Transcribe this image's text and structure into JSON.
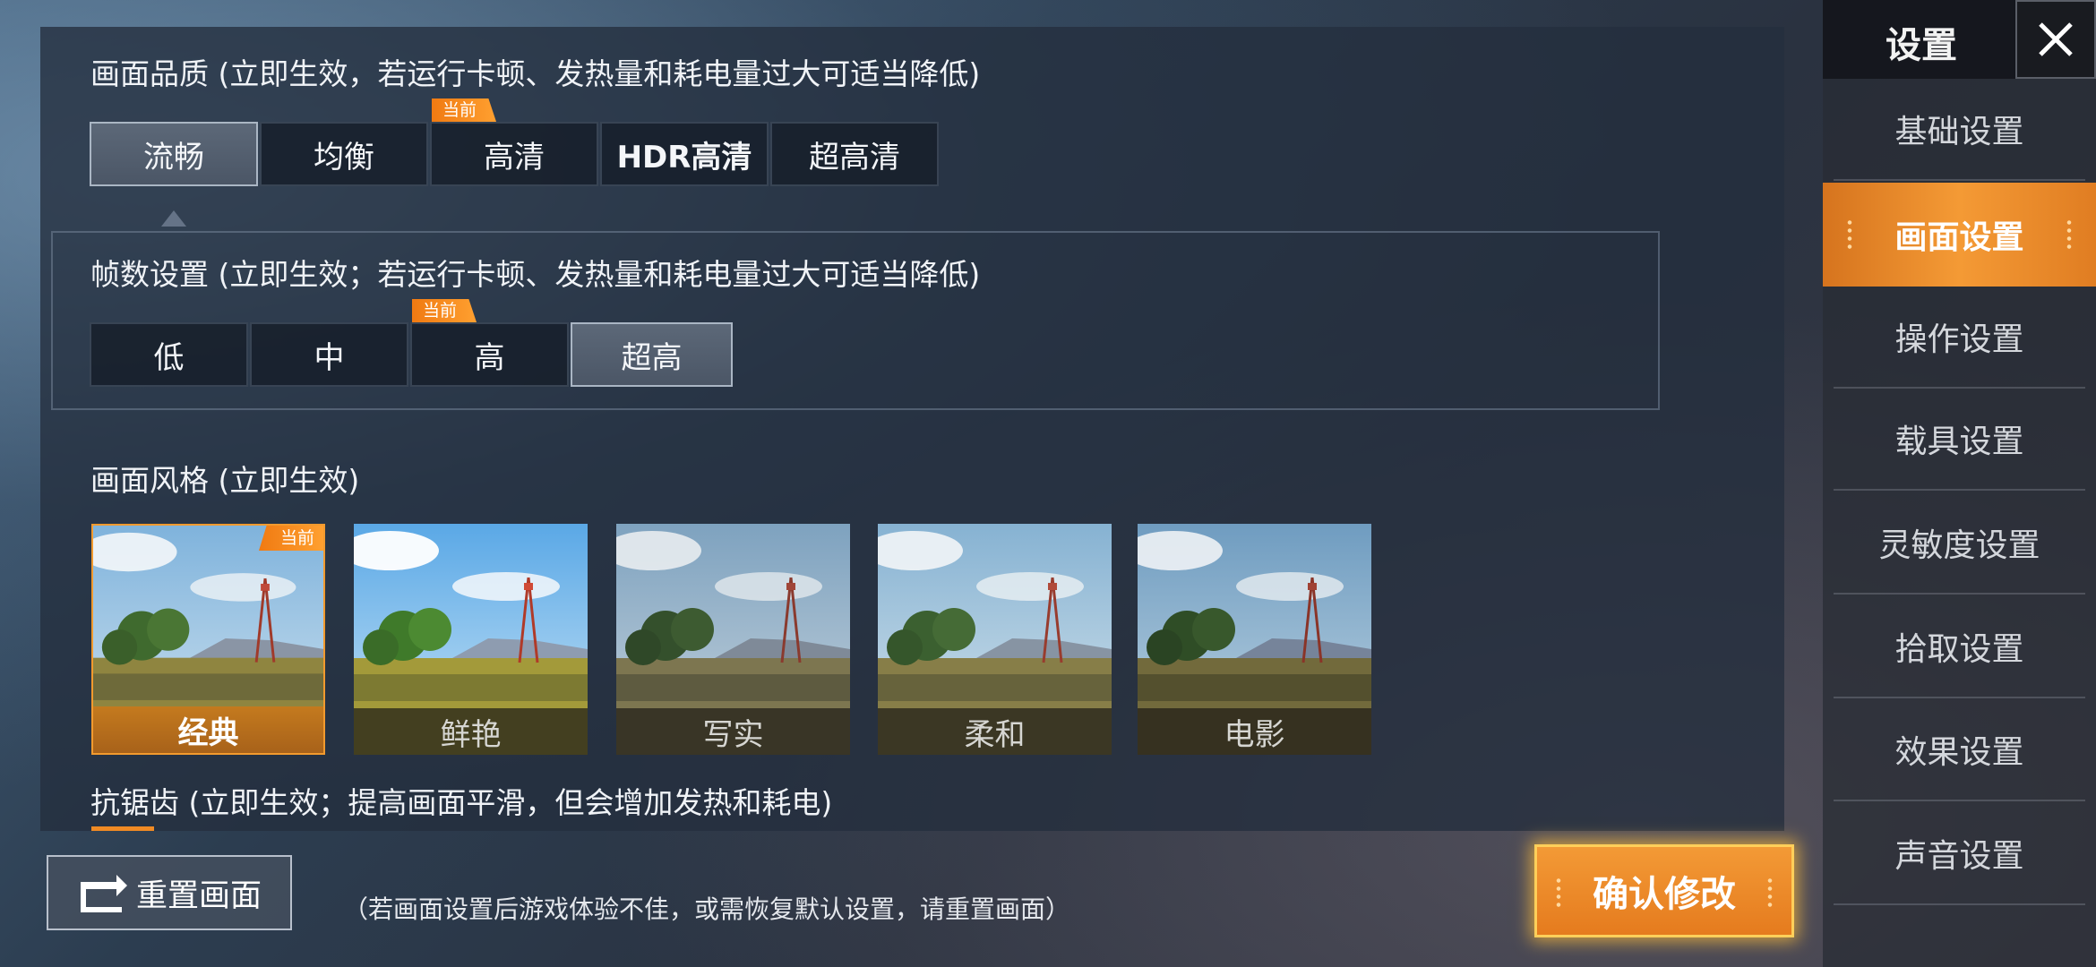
{
  "colors": {
    "accent": "#f08a24",
    "panel": "#242e3e",
    "selected_segment": "#566272"
  },
  "graphics": {
    "title": "画面品质 (立即生效，若运行卡顿、发热量和耗电量过大可适当降低)",
    "options": [
      "流畅",
      "均衡",
      "高清",
      "HDR高清",
      "超高清"
    ],
    "selected": "流畅",
    "current_tag": "当前"
  },
  "fps": {
    "title": "帧数设置 (立即生效；若运行卡顿、发热量和耗电量过大可适当降低)",
    "options": [
      "低",
      "中",
      "高",
      "超高"
    ],
    "selected": "超高",
    "current_tag": "当前"
  },
  "style": {
    "title": "画面风格 (立即生效)",
    "options": [
      "经典",
      "鲜艳",
      "写实",
      "柔和",
      "电影"
    ],
    "selected": "经典",
    "current_tag": "当前"
  },
  "antialias": {
    "title": "抗锯齿 (立即生效；提高画面平滑，但会增加发热和耗电)"
  },
  "sidebar": {
    "title": "设置",
    "items": [
      "基础设置",
      "画面设置",
      "操作设置",
      "载具设置",
      "灵敏度设置",
      "拾取设置",
      "效果设置",
      "声音设置"
    ],
    "active": "画面设置"
  },
  "bottom": {
    "reset_label": "重置画面",
    "reset_note": "（若画面设置后游戏体验不佳，或需恢复默认设置，请重置画面）",
    "confirm_label": "确认修改"
  }
}
